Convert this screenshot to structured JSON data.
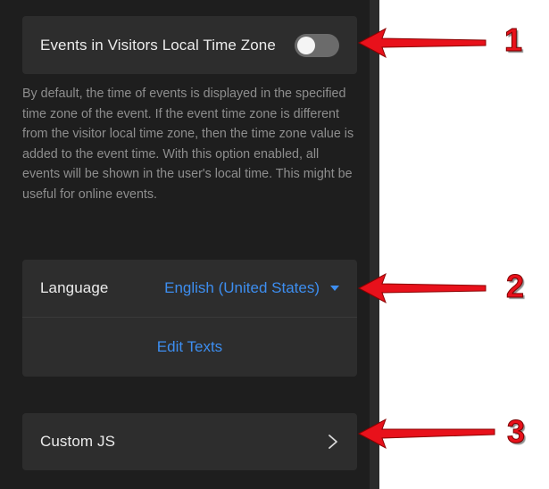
{
  "settings": {
    "local_time": {
      "label": "Events in Visitors Local Time Zone",
      "enabled": false,
      "description": "By default, the time of events is displayed in the specified time zone of the event. If the event time zone is different from the visitor local time zone, then the time zone value is added to the event time. With this option enabled, all events will be shown in the user's local time. This might be useful for online events."
    },
    "language": {
      "label": "Language",
      "selected": "English (United States)",
      "edit_texts": "Edit Texts"
    },
    "custom_js": {
      "label": "Custom JS"
    }
  },
  "annotations": {
    "numbers": [
      "1",
      "2",
      "3"
    ],
    "arrow_color": "#e8111b"
  },
  "colors": {
    "panel_bg": "#1e1e1e",
    "card_bg": "#2d2d2d",
    "accent": "#3d8ef0",
    "toggle_off": "#6b6b6b"
  },
  "icons": {
    "language_dropdown": "caret-down-icon",
    "custom_js": "chevron-right-icon"
  }
}
